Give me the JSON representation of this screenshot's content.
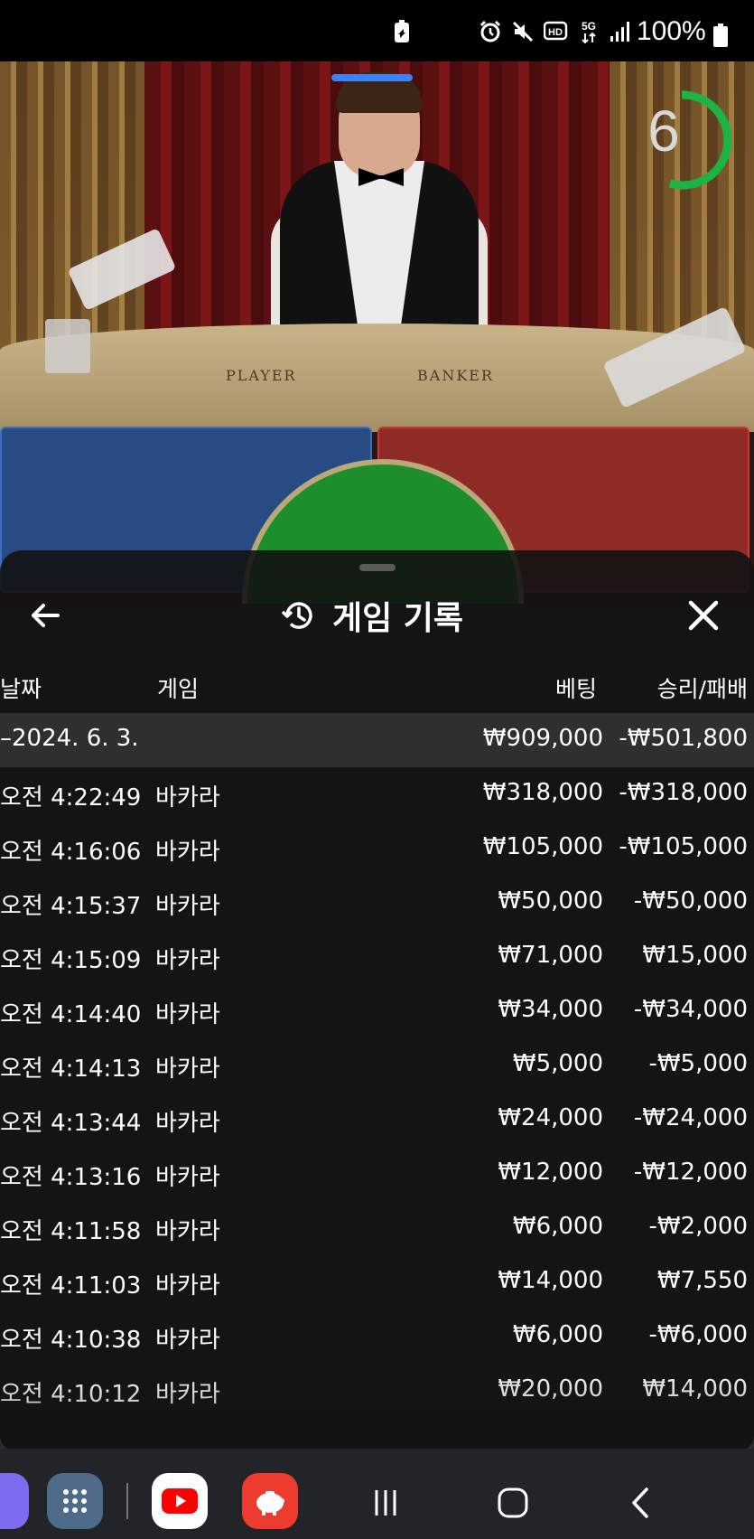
{
  "status_bar": {
    "battery_percent": "100%",
    "icons": [
      "battery-saver-icon",
      "alarm-icon",
      "mute-icon",
      "hd-voice-icon",
      "5g-icon",
      "signal-icon",
      "battery-icon"
    ]
  },
  "game": {
    "table_labels": {
      "player": "PLAYER",
      "banker": "BANKER"
    },
    "countdown": "6"
  },
  "panel": {
    "title": "게임 기록",
    "columns": {
      "date": "날짜",
      "game": "게임",
      "bet": "베팅",
      "result": "승리/패배"
    },
    "summary": {
      "date": "–2024. 6. 3.",
      "bet": "₩909,000",
      "result": "-₩501,800"
    },
    "rows": [
      {
        "time": "오전 4:22:49",
        "game": "바카라",
        "bet": "₩318,000",
        "result": "-₩318,000"
      },
      {
        "time": "오전 4:16:06",
        "game": "바카라",
        "bet": "₩105,000",
        "result": "-₩105,000"
      },
      {
        "time": "오전 4:15:37",
        "game": "바카라",
        "bet": "₩50,000",
        "result": "-₩50,000"
      },
      {
        "time": "오전 4:15:09",
        "game": "바카라",
        "bet": "₩71,000",
        "result": "₩15,000"
      },
      {
        "time": "오전 4:14:40",
        "game": "바카라",
        "bet": "₩34,000",
        "result": "-₩34,000"
      },
      {
        "time": "오전 4:14:13",
        "game": "바카라",
        "bet": "₩5,000",
        "result": "-₩5,000"
      },
      {
        "time": "오전 4:13:44",
        "game": "바카라",
        "bet": "₩24,000",
        "result": "-₩24,000"
      },
      {
        "time": "오전 4:13:16",
        "game": "바카라",
        "bet": "₩12,000",
        "result": "-₩12,000"
      },
      {
        "time": "오전 4:11:58",
        "game": "바카라",
        "bet": "₩6,000",
        "result": "-₩2,000"
      },
      {
        "time": "오전 4:11:03",
        "game": "바카라",
        "bet": "₩14,000",
        "result": "₩7,550"
      },
      {
        "time": "오전 4:10:38",
        "game": "바카라",
        "bet": "₩6,000",
        "result": "-₩6,000"
      },
      {
        "time": "오전 4:10:12",
        "game": "바카라",
        "bet": "₩20,000",
        "result": "₩14,000"
      }
    ]
  },
  "nav": {
    "apps": [
      "messenger-app",
      "app-drawer",
      "youtube-app",
      "piggy-bank-app"
    ],
    "buttons": [
      "recents-button",
      "home-button",
      "back-button"
    ]
  },
  "colors": {
    "player_blue": "#284b83",
    "banker_red": "#8e2b26",
    "tie_green": "#1c8e2b",
    "timer_green": "#1db446",
    "panel_bg": "#121212"
  }
}
